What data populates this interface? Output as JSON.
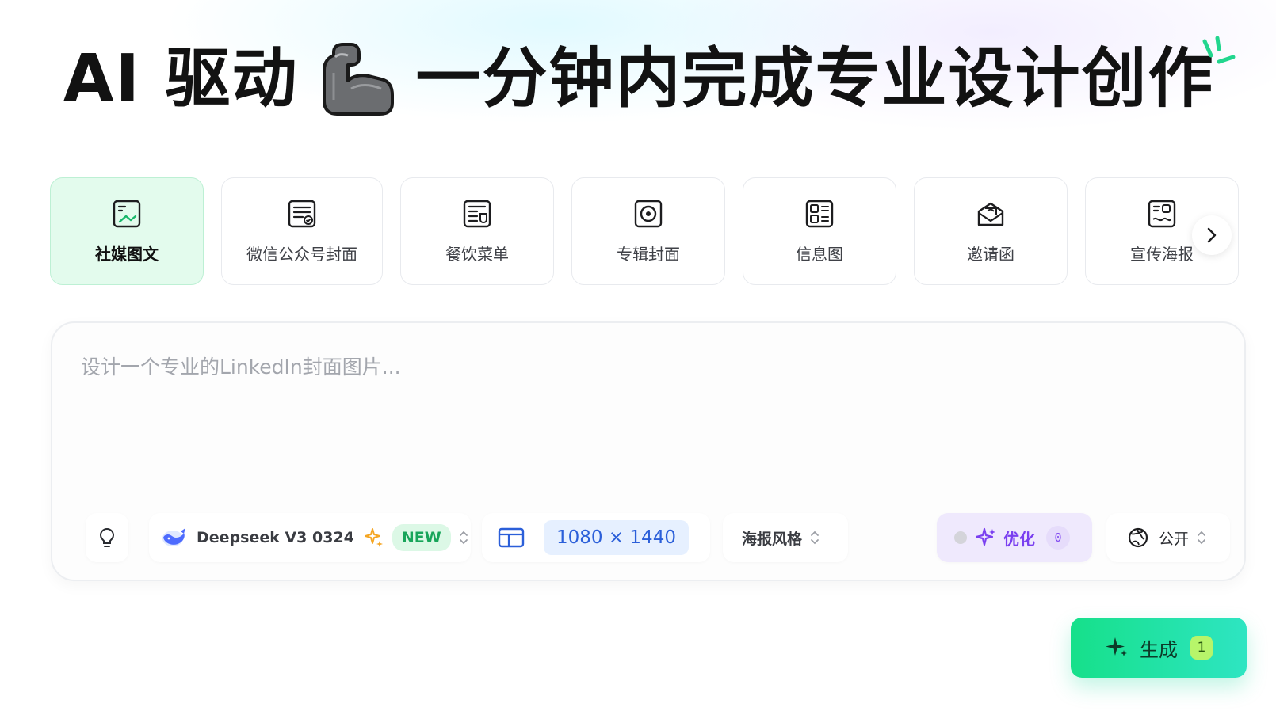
{
  "hero": {
    "title_left": "AI 驱动",
    "title_right": "一分钟内完成专业设计创作",
    "icon": "flexed-arm-icon"
  },
  "categories": [
    {
      "label": "社媒图文",
      "icon": "social-post-icon",
      "active": true
    },
    {
      "label": "微信公众号封面",
      "icon": "wechat-cover-icon",
      "active": false
    },
    {
      "label": "餐饮菜单",
      "icon": "menu-icon",
      "active": false
    },
    {
      "label": "专辑封面",
      "icon": "album-cover-icon",
      "active": false
    },
    {
      "label": "信息图",
      "icon": "infographic-icon",
      "active": false
    },
    {
      "label": "邀请函",
      "icon": "invitation-icon",
      "active": false
    },
    {
      "label": "宣传海报",
      "icon": "poster-icon",
      "active": false
    }
  ],
  "prompt": {
    "placeholder": "设计一个专业的LinkedIn封面图片...",
    "value": ""
  },
  "toolbar": {
    "model": {
      "name": "Deepseek V3 0324",
      "badge": "NEW"
    },
    "size": {
      "value": "1080 × 1440"
    },
    "style": {
      "label": "海报风格"
    },
    "optimize": {
      "label": "优化",
      "count": "0"
    },
    "visibility": {
      "label": "公开"
    }
  },
  "generate": {
    "label": "生成",
    "count": "1"
  },
  "colors": {
    "accent_green": "#16e08a",
    "active_card_bg": "#e3fbed",
    "size_blue": "#2b5fd9",
    "optimize_purple": "#7a3ff0",
    "new_badge_green": "#18a55a"
  }
}
